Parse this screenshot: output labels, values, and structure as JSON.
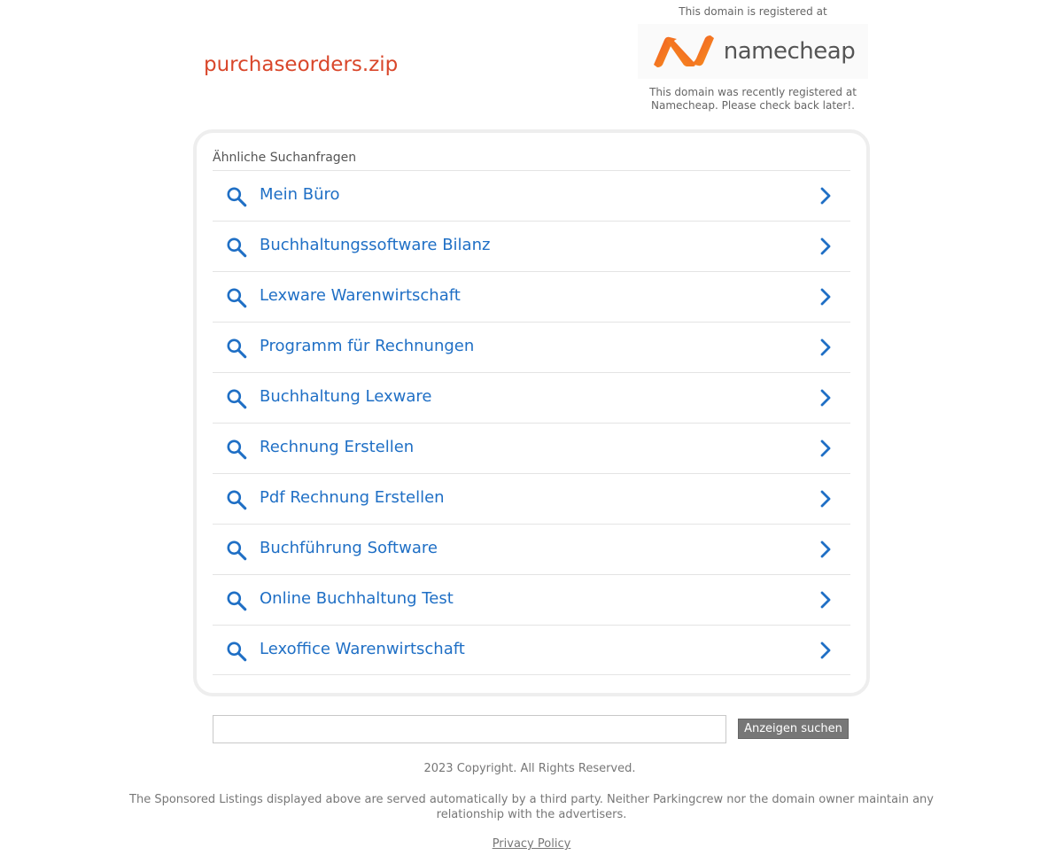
{
  "domain": {
    "name": "purchaseorders.zip",
    "color": "#d9472b"
  },
  "registrar": {
    "registered_at_text": "This domain is registered at",
    "logo_text": "namecheap",
    "recent_text_line1": "This domain was recently registered at",
    "recent_text_line2": "Namecheap. Please check back later!.",
    "brand_color": "#f26b22"
  },
  "related": {
    "heading": "Ähnliche Suchanfragen",
    "link_color": "#1f6fc5",
    "items": [
      {
        "label": "Mein Büro",
        "icon": "search-icon"
      },
      {
        "label": "Buchhaltungssoftware Bilanz",
        "icon": "search-icon"
      },
      {
        "label": "Lexware Warenwirtschaft",
        "icon": "search-icon"
      },
      {
        "label": "Programm für Rechnungen",
        "icon": "search-icon"
      },
      {
        "label": "Buchhaltung Lexware",
        "icon": "search-icon"
      },
      {
        "label": "Rechnung Erstellen",
        "icon": "search-icon"
      },
      {
        "label": "Pdf Rechnung Erstellen",
        "icon": "search-icon"
      },
      {
        "label": "Buchführung Software",
        "icon": "search-icon"
      },
      {
        "label": "Online Buchhaltung Test",
        "icon": "search-icon"
      },
      {
        "label": "Lexoffice Warenwirtschaft",
        "icon": "search-icon"
      }
    ]
  },
  "search": {
    "value": "",
    "button_label": "Anzeigen suchen"
  },
  "footer": {
    "copyright": "2023 Copyright. All Rights Reserved.",
    "disclaimer": "The Sponsored Listings displayed above are served automatically by a third party. Neither Parkingcrew nor the domain owner maintain any relationship with the advertisers.",
    "privacy_label": "Privacy Policy"
  }
}
